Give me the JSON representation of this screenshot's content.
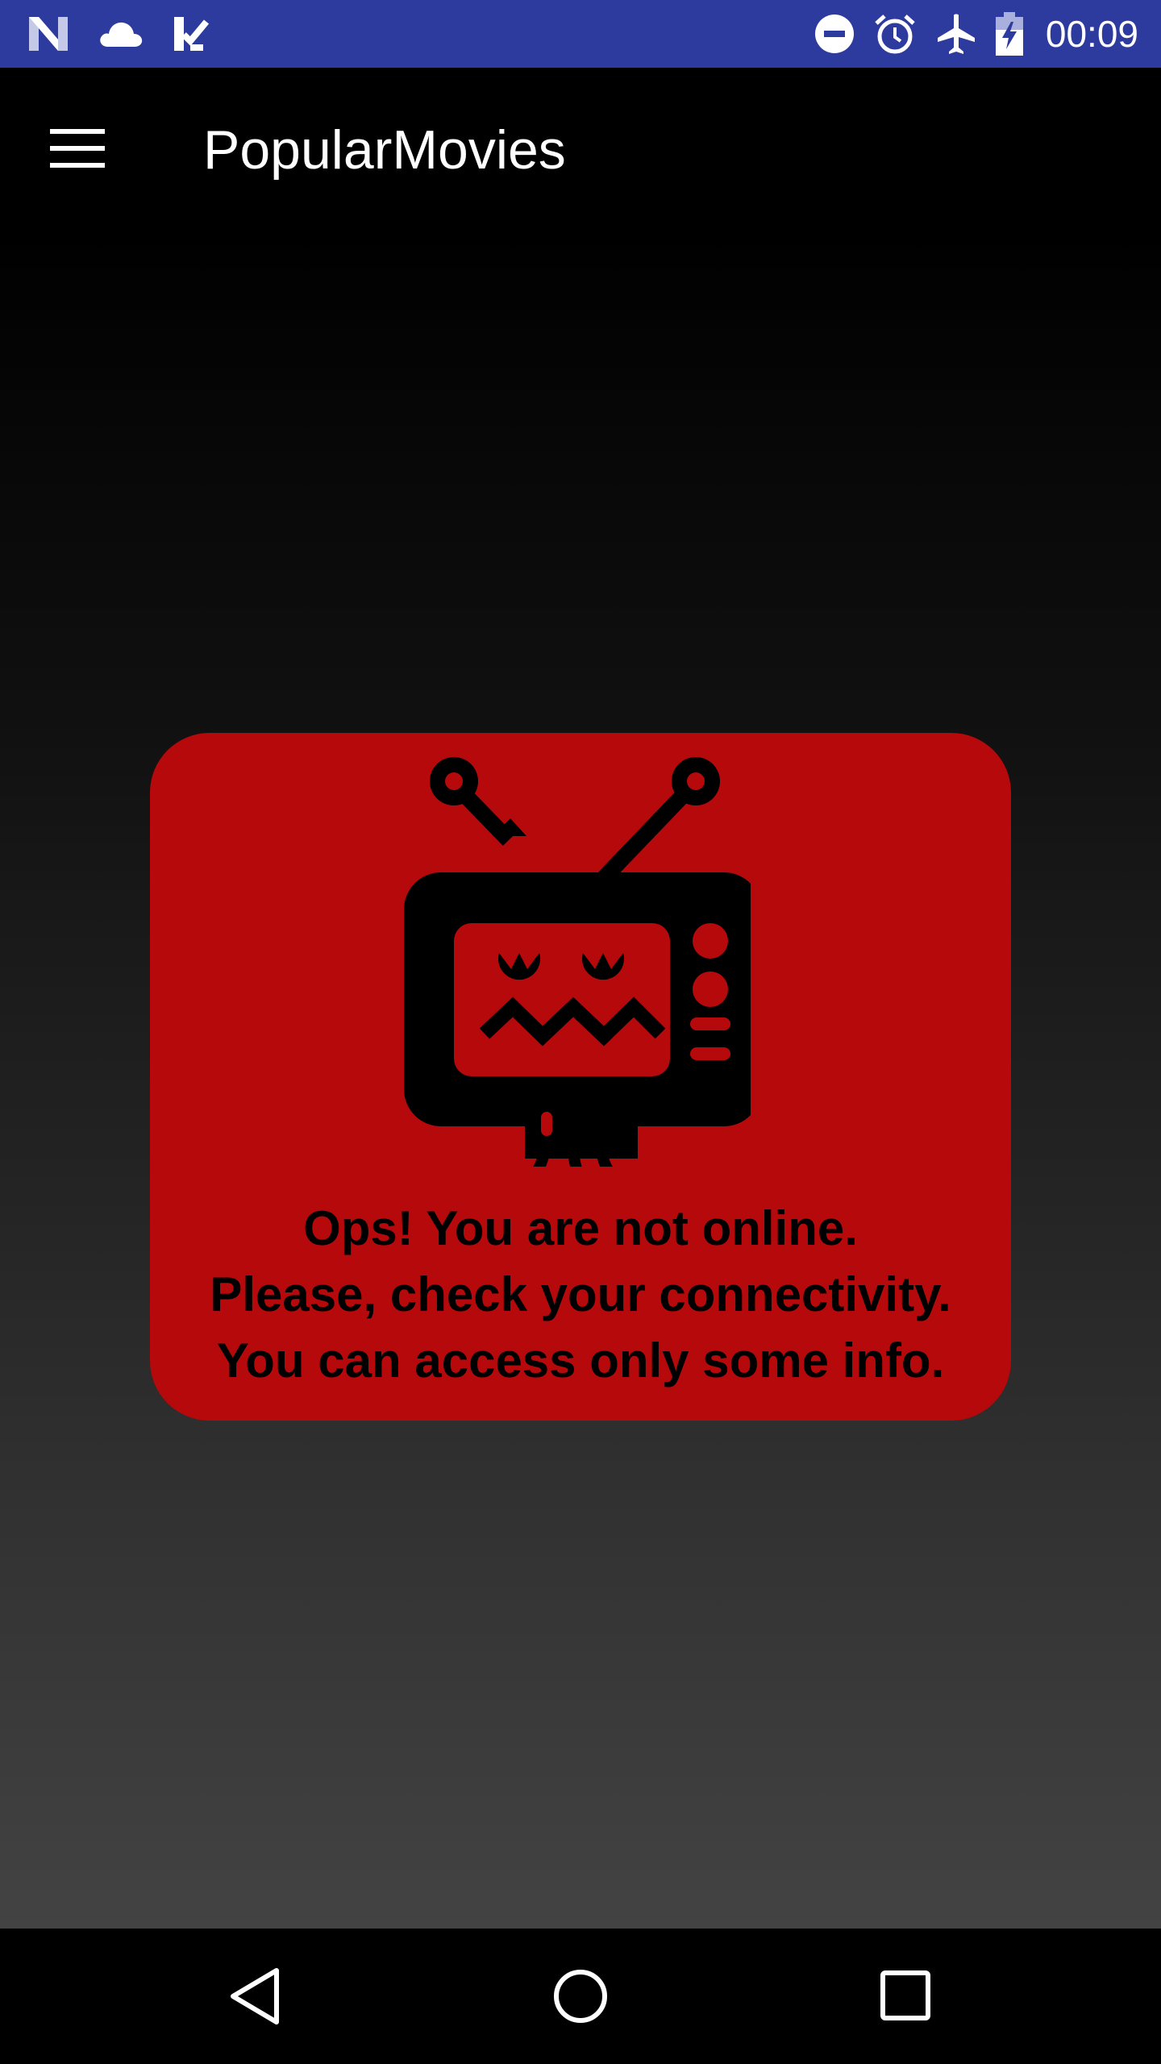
{
  "status_bar": {
    "time": "00:09",
    "left_icons": [
      "n-logo-icon",
      "cloud-icon",
      "check-list-icon"
    ],
    "right_icons": [
      "do-not-disturb-icon",
      "alarm-icon",
      "airplane-mode-icon",
      "battery-charging-icon"
    ],
    "background_color": "#2e3b9e"
  },
  "app_bar": {
    "title": "PopularMovies",
    "menu_icon": "hamburger-menu-icon"
  },
  "offline_card": {
    "icon": "sad-tv-robot-icon",
    "message_lines": [
      "Ops! You are not online.",
      "Please, check your connectivity.",
      "You can access only some info."
    ],
    "card_color": "#b5090b"
  },
  "nav_bar": {
    "buttons": [
      "back-icon",
      "home-icon",
      "recents-icon"
    ]
  }
}
